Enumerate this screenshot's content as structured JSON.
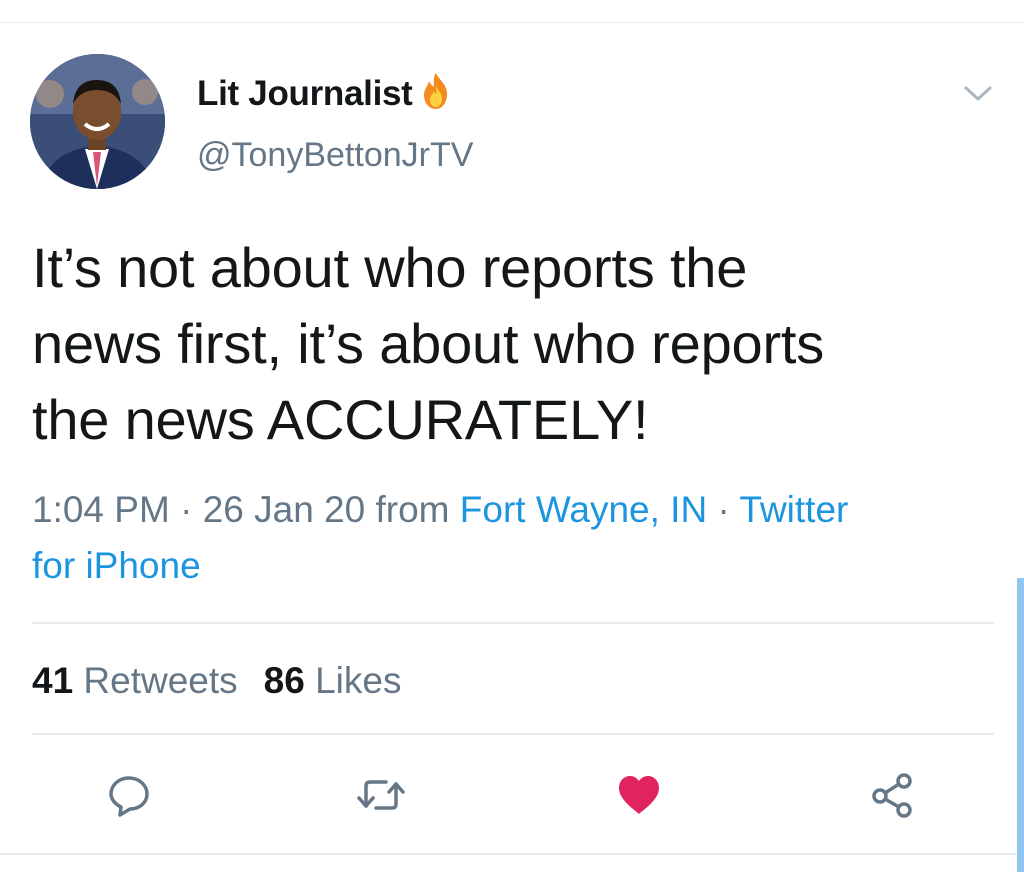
{
  "author": {
    "display_name": "Lit Journalist",
    "handle": "@TonyBettonJrTV",
    "name_emoji_icon": "fire-icon",
    "avatar_icon": "profile-photo"
  },
  "tweet": {
    "text_lines": [
      "It’s not about who reports the",
      "news first, it’s about who reports",
      "the news ACCURATELY!"
    ]
  },
  "meta": {
    "time": "1:04 PM",
    "sep1": " · ",
    "date": "26 Jan 20",
    "from_label": " from ",
    "location": "Fort Wayne, IN",
    "sep2": " · ",
    "source_part1": "Twitter",
    "source_part2": "for iPhone"
  },
  "stats": {
    "retweets_count": "41",
    "retweets_label": " Retweets",
    "likes_count": "86",
    "likes_label": " Likes"
  },
  "actions": {
    "reply_icon": "reply-icon",
    "retweet_icon": "retweet-icon",
    "like_icon": "heart-icon",
    "share_icon": "share-icon"
  },
  "colors": {
    "text": "#14171a",
    "secondary": "#657786",
    "link": "#1b95e0",
    "like": "#e0245e",
    "divider": "#e6ecf0"
  }
}
